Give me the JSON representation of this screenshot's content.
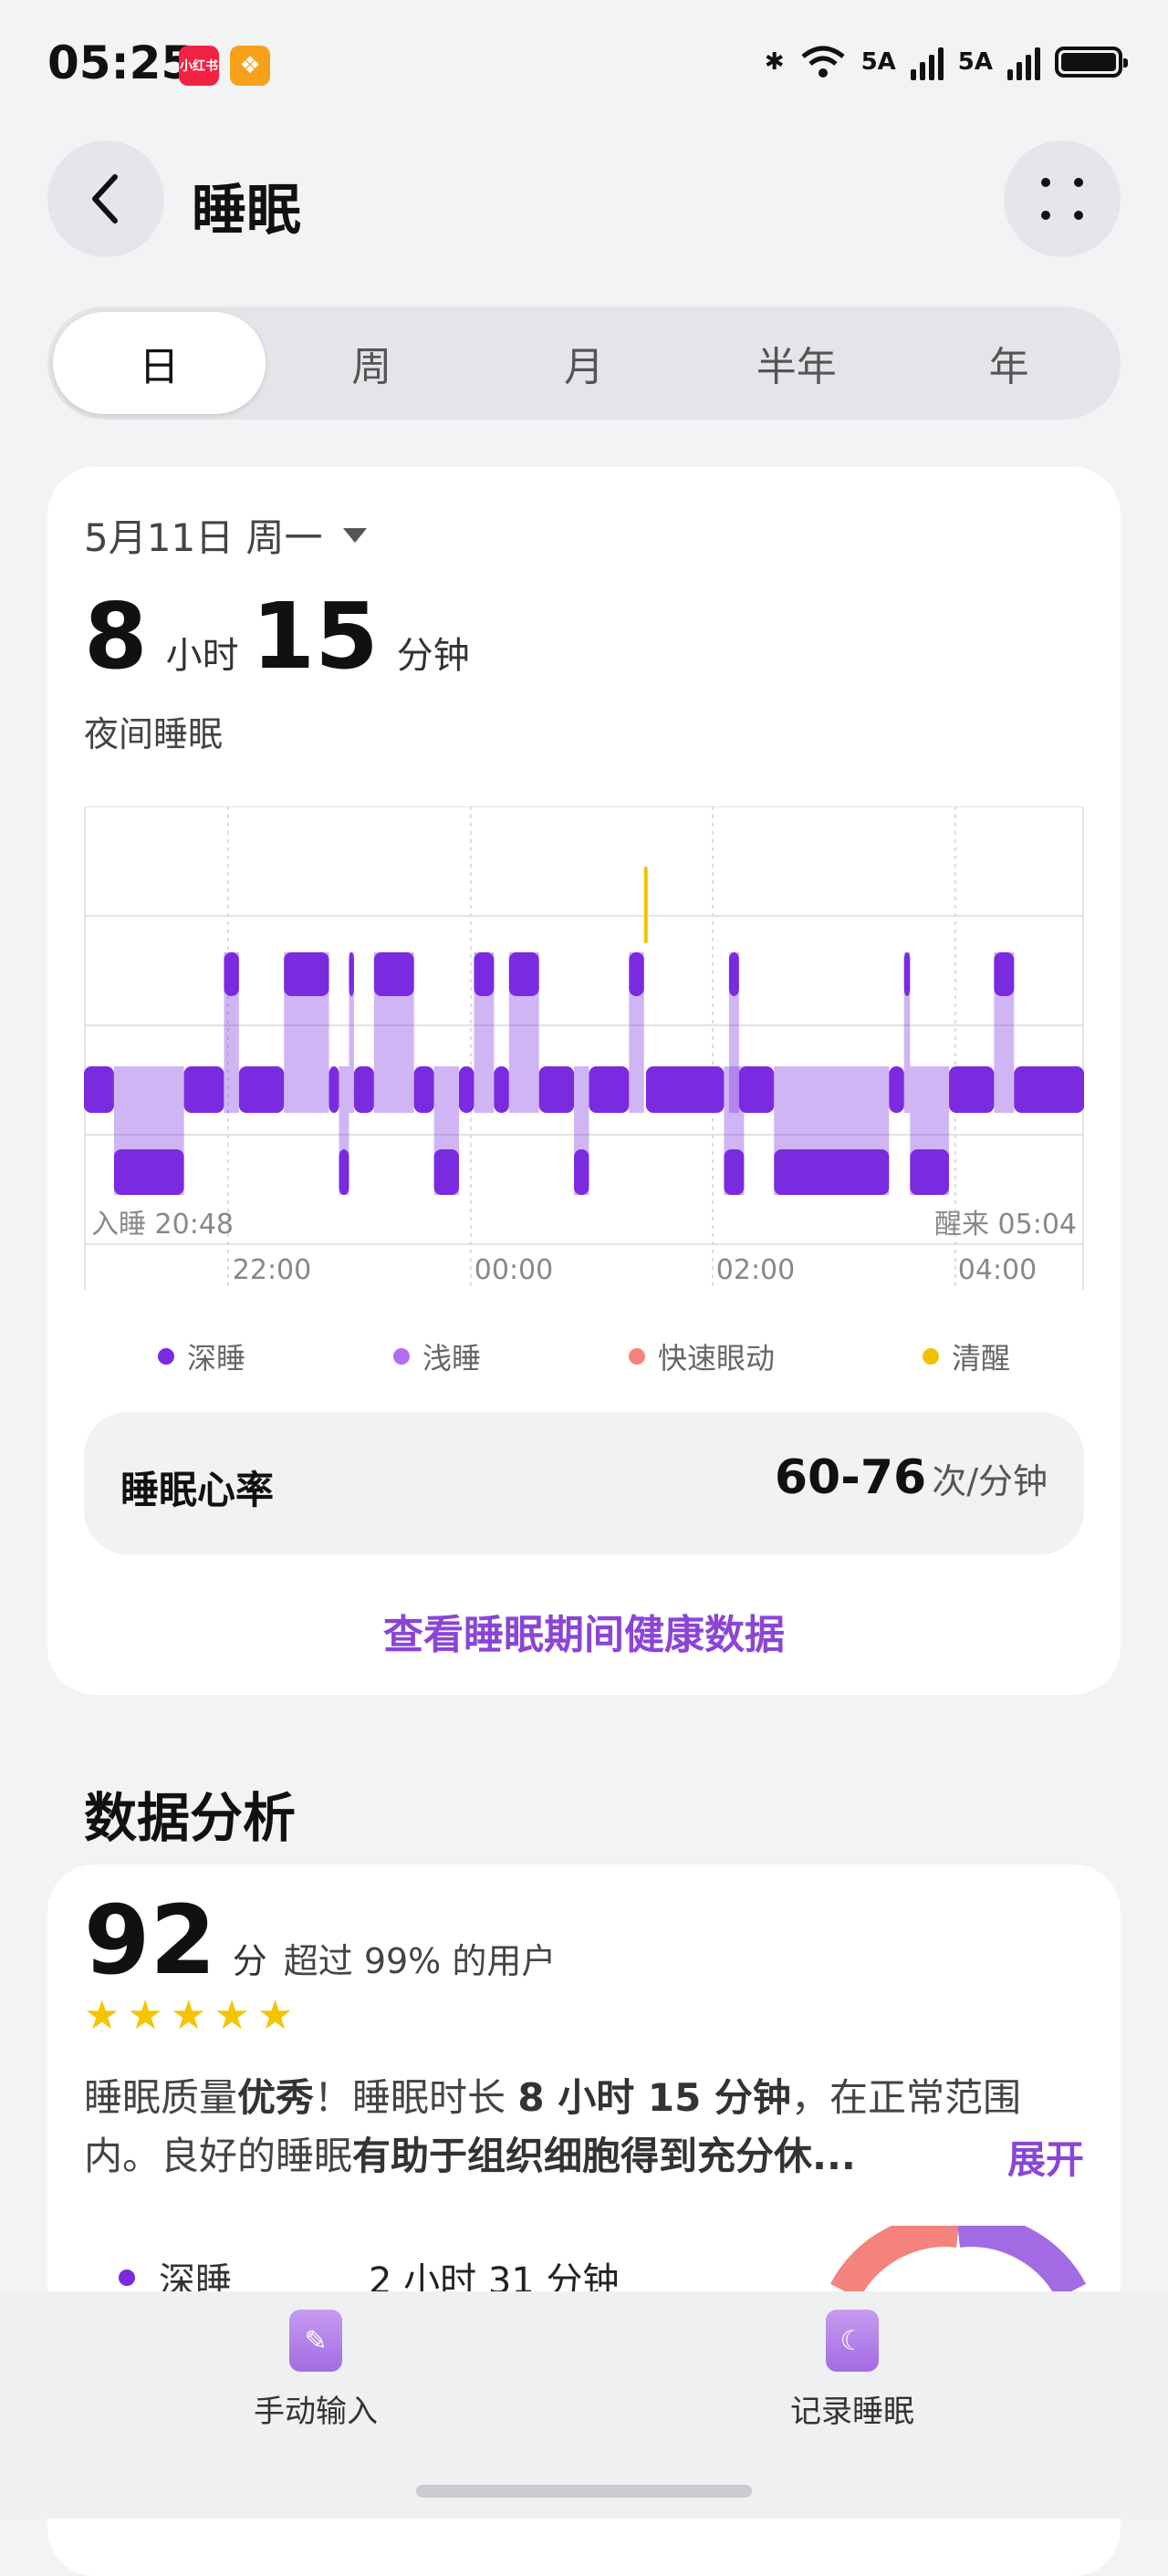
{
  "status_bar": {
    "time": "05:25",
    "app_badge_1": "小红书",
    "network_1": "5A",
    "network_2": "5A"
  },
  "header": {
    "title": "睡眠",
    "back_icon": "chevron-left-icon",
    "more_icon": "four-dots-icon"
  },
  "tabs": [
    "日",
    "周",
    "月",
    "半年",
    "年"
  ],
  "active_tab": "日",
  "summary": {
    "date": "5月11日 周一",
    "hours": "8",
    "hours_unit": "小时",
    "minutes": "15",
    "minutes_unit": "分钟",
    "label": "夜间睡眠"
  },
  "chart": {
    "start_label": "入睡 20:48",
    "end_label": "醒来 05:04",
    "x_ticks": [
      "22:00",
      "00:00",
      "02:00",
      "04:00"
    ]
  },
  "chart_data": {
    "type": "area",
    "x_range": [
      "20:48",
      "05:04"
    ],
    "stages": [
      "清醒",
      "快速眼动",
      "浅睡",
      "深睡"
    ],
    "segments": [
      {
        "stage": "浅睡",
        "start": 0.0,
        "end": 0.03
      },
      {
        "stage": "深睡",
        "start": 0.03,
        "end": 0.1
      },
      {
        "stage": "浅睡",
        "start": 0.1,
        "end": 0.14
      },
      {
        "stage": "快速眼动",
        "start": 0.14,
        "end": 0.155
      },
      {
        "stage": "浅睡",
        "start": 0.155,
        "end": 0.2
      },
      {
        "stage": "快速眼动",
        "start": 0.2,
        "end": 0.245
      },
      {
        "stage": "浅睡",
        "start": 0.245,
        "end": 0.255
      },
      {
        "stage": "深睡",
        "start": 0.255,
        "end": 0.265
      },
      {
        "stage": "快速眼动",
        "start": 0.265,
        "end": 0.27
      },
      {
        "stage": "浅睡",
        "start": 0.27,
        "end": 0.29
      },
      {
        "stage": "快速眼动",
        "start": 0.29,
        "end": 0.33
      },
      {
        "stage": "浅睡",
        "start": 0.33,
        "end": 0.35
      },
      {
        "stage": "深睡",
        "start": 0.35,
        "end": 0.375
      },
      {
        "stage": "浅睡",
        "start": 0.375,
        "end": 0.39
      },
      {
        "stage": "快速眼动",
        "start": 0.39,
        "end": 0.41
      },
      {
        "stage": "浅睡",
        "start": 0.41,
        "end": 0.425
      },
      {
        "stage": "快速眼动",
        "start": 0.425,
        "end": 0.455
      },
      {
        "stage": "浅睡",
        "start": 0.455,
        "end": 0.49
      },
      {
        "stage": "深睡",
        "start": 0.49,
        "end": 0.505
      },
      {
        "stage": "浅睡",
        "start": 0.505,
        "end": 0.545
      },
      {
        "stage": "快速眼动",
        "start": 0.545,
        "end": 0.56
      },
      {
        "stage": "清醒",
        "start": 0.56,
        "end": 0.562
      },
      {
        "stage": "浅睡",
        "start": 0.562,
        "end": 0.64
      },
      {
        "stage": "深睡",
        "start": 0.64,
        "end": 0.66
      },
      {
        "stage": "浅睡",
        "start": 0.66,
        "end": 0.645
      },
      {
        "stage": "快速眼动",
        "start": 0.645,
        "end": 0.655
      },
      {
        "stage": "浅睡",
        "start": 0.655,
        "end": 0.69
      },
      {
        "stage": "深睡",
        "start": 0.69,
        "end": 0.805
      },
      {
        "stage": "浅睡",
        "start": 0.805,
        "end": 0.82
      },
      {
        "stage": "快速眼动",
        "start": 0.82,
        "end": 0.826
      },
      {
        "stage": "深睡",
        "start": 0.826,
        "end": 0.865
      },
      {
        "stage": "浅睡",
        "start": 0.865,
        "end": 0.91
      },
      {
        "stage": "快速眼动",
        "start": 0.91,
        "end": 0.93
      },
      {
        "stage": "浅睡",
        "start": 0.93,
        "end": 1.0
      }
    ]
  },
  "legend": [
    {
      "label": "深睡",
      "color": "#7a2be0"
    },
    {
      "label": "浅睡",
      "color": "#b06ef2"
    },
    {
      "label": "快速眼动",
      "color": "#f5837d"
    },
    {
      "label": "清醒",
      "color": "#f2c200"
    }
  ],
  "heart_rate": {
    "label": "睡眠心率",
    "value": "60-76",
    "unit": "次/分钟"
  },
  "health_link": "查看睡眠期间健康数据",
  "analysis": {
    "title": "数据分析",
    "score": "92",
    "score_unit": "分",
    "score_desc": "超过 99% 的用户",
    "stars": 5,
    "quality_parts": [
      "睡眠质量",
      "优秀",
      "！睡眠时长 ",
      "8 小时 15 分钟",
      "，在正常范围内。良好的睡眠",
      "有助于组织细胞得到充分休..."
    ],
    "expand": "展开",
    "deep_label": "深睡",
    "deep_value": "2 小时 31 分钟"
  },
  "bottom_bar": {
    "manual_input": "手动输入",
    "record_sleep": "记录睡眠"
  }
}
